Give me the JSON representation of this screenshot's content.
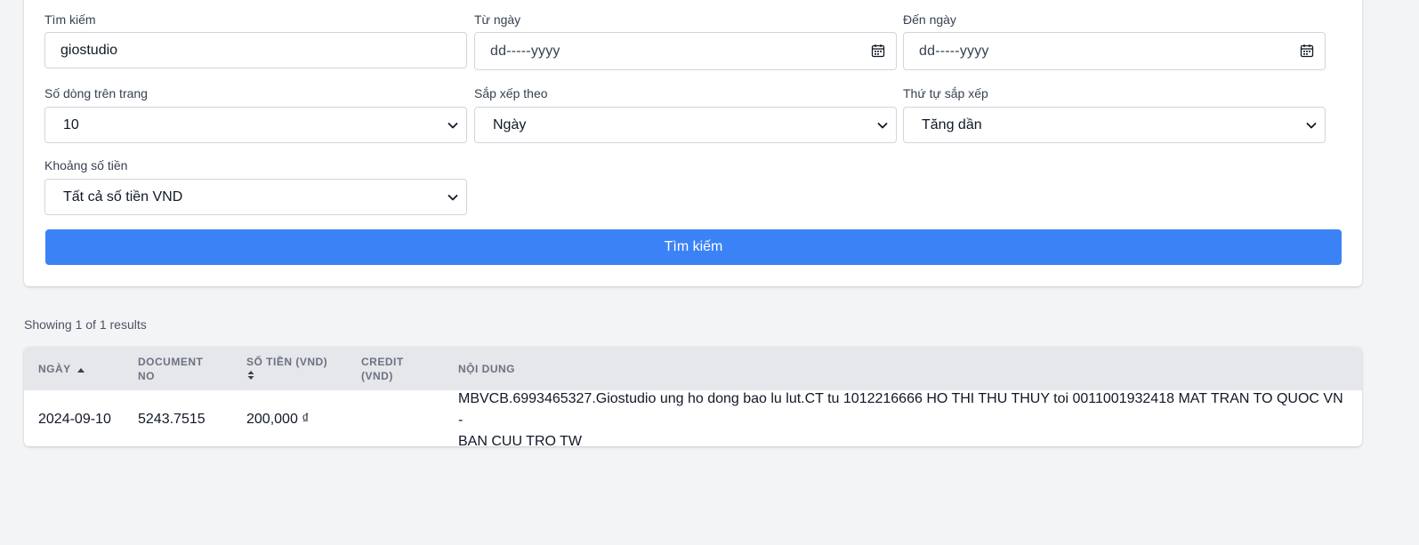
{
  "filters": {
    "search": {
      "label": "Tìm kiếm",
      "value": "giostudio"
    },
    "from_date": {
      "label": "Từ ngày",
      "placeholder": "dd-----yyyy"
    },
    "to_date": {
      "label": "Đến ngày",
      "placeholder": "dd-----yyyy"
    },
    "rows_per_page": {
      "label": "Số dòng trên trang",
      "selected": "10"
    },
    "sort_by": {
      "label": "Sắp xếp theo",
      "selected": "Ngày"
    },
    "sort_order": {
      "label": "Thứ tự sắp xếp",
      "selected": "Tăng dần"
    },
    "amount_range": {
      "label": "Khoảng số tiền",
      "selected": "Tất cả số tiền VND"
    },
    "submit_label": "Tìm kiếm"
  },
  "results": {
    "summary": "Showing 1 of 1 results",
    "columns": {
      "date": "Ngày",
      "doc_line1": "Document",
      "doc_line2": "No",
      "amount": "Số tiền (VND)",
      "credit_line1": "Credit",
      "credit_line2": "(VND)",
      "content": "Nội dung"
    },
    "rows": [
      {
        "date": "2024-09-10",
        "document_no": "5243.7515",
        "amount": "200,000 ₫",
        "credit": "",
        "content_line1": "MBVCB.6993465327.Giostudio ung ho dong bao lu lut.CT tu 1012216666 HO THI THU THUY toi 0011001932418 MAT TRAN TO QUOC VN -",
        "content_line2": "BAN CUU TRO TW"
      }
    ]
  },
  "colors": {
    "accent": "#3b82f6",
    "page_bg": "#f3f4f6",
    "header_bg": "#e5e7eb"
  }
}
